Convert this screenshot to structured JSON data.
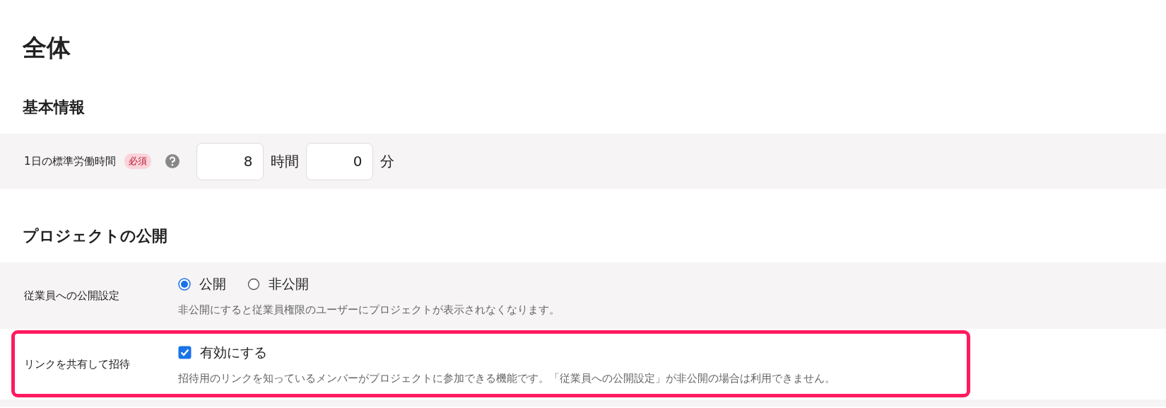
{
  "page_title": "全体",
  "sections": [
    {
      "heading": "基本情報",
      "rows": [
        {
          "kind": "duration",
          "label": "1日の標準労働時間",
          "badge": "必須",
          "fields": [
            {
              "value": "8",
              "unit": "時間"
            },
            {
              "value": "0",
              "unit": "分"
            }
          ]
        }
      ]
    },
    {
      "heading": "プロジェクトの公開",
      "rows": [
        {
          "kind": "radio",
          "label": "従業員への公開設定",
          "options": [
            {
              "label": "公開",
              "selected": true
            },
            {
              "label": "非公開",
              "selected": false
            }
          ],
          "note": "非公開にすると従業員権限のユーザーにプロジェクトが表示されなくなります。"
        },
        {
          "kind": "checkbox",
          "label": "リンクを共有して招待",
          "option": {
            "label": "有効にする",
            "checked": true
          },
          "note": "招待用のリンクを知っているメンバーがプロジェクトに参加できる機能です。「従業員への公開設定」が非公開の場合は利用できません。",
          "highlighted": true
        }
      ]
    }
  ]
}
